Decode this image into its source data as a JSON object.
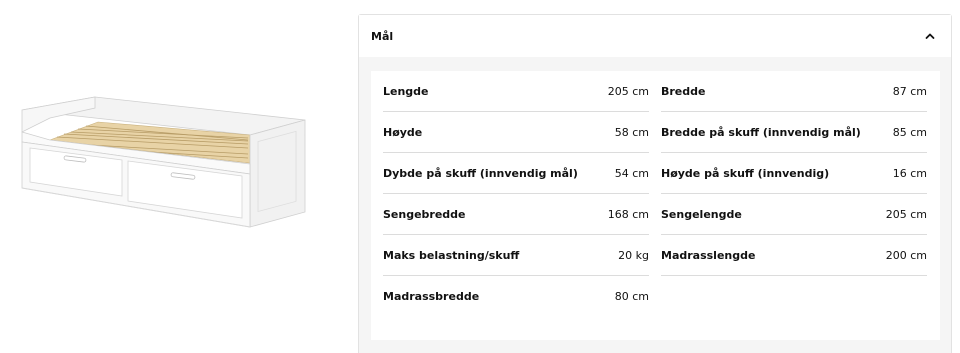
{
  "panel": {
    "title": "Mål"
  },
  "icons": {
    "collapse": "chevron-up-icon"
  },
  "colors": {
    "panel_bg": "#f5f5f5",
    "divider": "#dcdcdc",
    "text": "#111111"
  },
  "left_column": [
    {
      "label": "Lengde",
      "value": "205 cm"
    },
    {
      "label": "Høyde",
      "value": "58 cm"
    },
    {
      "label": "Dybde på skuff (innvendig mål)",
      "value": "54 cm"
    },
    {
      "label": "Sengebredde",
      "value": "168 cm"
    },
    {
      "label": "Maks belastning/skuff",
      "value": "20 kg"
    },
    {
      "label": "Madrassbredde",
      "value": "80 cm"
    }
  ],
  "right_column": [
    {
      "label": "Bredde",
      "value": "87 cm"
    },
    {
      "label": "Bredde på skuff (innvendig mål)",
      "value": "85 cm"
    },
    {
      "label": "Høyde på skuff (innvendig)",
      "value": "16 cm"
    },
    {
      "label": "Sengelengde",
      "value": "205 cm"
    },
    {
      "label": "Madrasslengde",
      "value": "200 cm"
    }
  ]
}
